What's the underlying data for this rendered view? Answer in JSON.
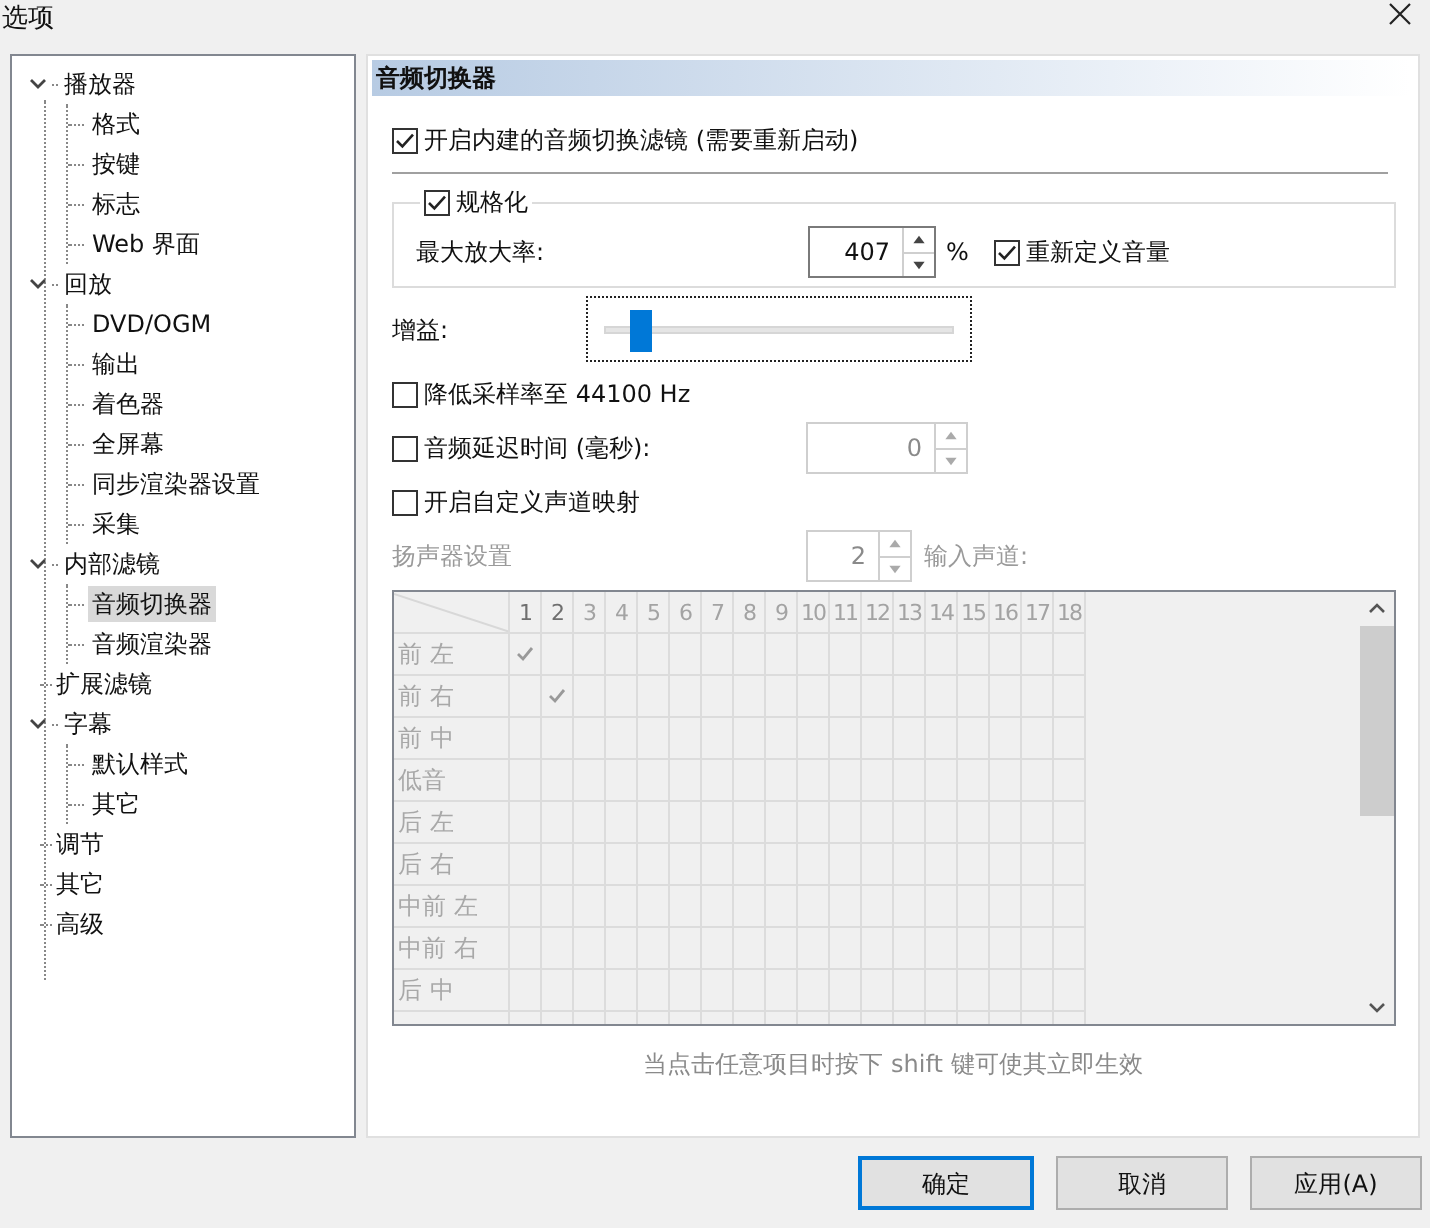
{
  "window": {
    "title": "选项"
  },
  "tree": [
    {
      "label": "播放器",
      "expanded": true,
      "selected": false,
      "children": [
        {
          "label": "格式",
          "selected": false
        },
        {
          "label": "按键",
          "selected": false
        },
        {
          "label": "标志",
          "selected": false
        },
        {
          "label": "Web 界面",
          "selected": false
        }
      ]
    },
    {
      "label": "回放",
      "expanded": true,
      "selected": false,
      "children": [
        {
          "label": "DVD/OGM",
          "selected": false
        },
        {
          "label": "输出",
          "selected": false
        },
        {
          "label": "着色器",
          "selected": false
        },
        {
          "label": "全屏幕",
          "selected": false
        },
        {
          "label": "同步渲染器设置",
          "selected": false
        },
        {
          "label": "采集",
          "selected": false
        }
      ]
    },
    {
      "label": "内部滤镜",
      "expanded": true,
      "selected": false,
      "children": [
        {
          "label": "音频切换器",
          "selected": true
        },
        {
          "label": "音频渲染器",
          "selected": false
        }
      ]
    },
    {
      "label": "扩展滤镜",
      "selected": false
    },
    {
      "label": "字幕",
      "expanded": true,
      "selected": false,
      "children": [
        {
          "label": "默认样式",
          "selected": false
        },
        {
          "label": "其它",
          "selected": false
        }
      ]
    },
    {
      "label": "调节",
      "selected": false
    },
    {
      "label": "其它",
      "selected": false
    },
    {
      "label": "高级",
      "selected": false
    }
  ],
  "panel": {
    "title": "音频切换器",
    "enable_filter": {
      "label": "开启内建的音频切换滤镜 (需要重新启动)",
      "checked": true
    },
    "normalize": {
      "label": "规格化",
      "checked": true,
      "max_amp_label": "最大放大率:",
      "max_amp_value": "407",
      "unit": "%",
      "regain": {
        "label": "重新定义音量",
        "checked": true
      }
    },
    "gain": {
      "label": "增益:",
      "level": 0.1
    },
    "downsample": {
      "label": "降低采样率至 44100 Hz",
      "checked": false
    },
    "delay": {
      "label": "音频延迟时间 (毫秒):",
      "checked": false,
      "value": "0",
      "disabled": true
    },
    "custom_mapping": {
      "label": "开启自定义声道映射",
      "checked": false
    },
    "speaker": {
      "label": "扬声器设置",
      "value": "2",
      "input_label": "输入声道:",
      "disabled": true
    },
    "grid": {
      "columns": [
        {
          "label": "1",
          "active": true
        },
        {
          "label": "2",
          "active": true
        },
        {
          "label": "3",
          "active": false
        },
        {
          "label": "4",
          "active": false
        },
        {
          "label": "5",
          "active": false
        },
        {
          "label": "6",
          "active": false
        },
        {
          "label": "7",
          "active": false
        },
        {
          "label": "8",
          "active": false
        },
        {
          "label": "9",
          "active": false
        },
        {
          "label": "10",
          "active": false
        },
        {
          "label": "11",
          "active": false
        },
        {
          "label": "12",
          "active": false
        },
        {
          "label": "13",
          "active": false
        },
        {
          "label": "14",
          "active": false
        },
        {
          "label": "15",
          "active": false
        },
        {
          "label": "16",
          "active": false
        },
        {
          "label": "17",
          "active": false
        },
        {
          "label": "18",
          "active": false
        }
      ],
      "rows": [
        {
          "label": "前 左",
          "checked": [
            true,
            false,
            false,
            false,
            false,
            false,
            false,
            false,
            false,
            false,
            false,
            false,
            false,
            false,
            false,
            false,
            false,
            false
          ]
        },
        {
          "label": "前 右",
          "checked": [
            false,
            true,
            false,
            false,
            false,
            false,
            false,
            false,
            false,
            false,
            false,
            false,
            false,
            false,
            false,
            false,
            false,
            false
          ]
        },
        {
          "label": "前 中",
          "checked": [
            false,
            false,
            false,
            false,
            false,
            false,
            false,
            false,
            false,
            false,
            false,
            false,
            false,
            false,
            false,
            false,
            false,
            false
          ]
        },
        {
          "label": "低音",
          "checked": [
            false,
            false,
            false,
            false,
            false,
            false,
            false,
            false,
            false,
            false,
            false,
            false,
            false,
            false,
            false,
            false,
            false,
            false
          ]
        },
        {
          "label": "后 左",
          "checked": [
            false,
            false,
            false,
            false,
            false,
            false,
            false,
            false,
            false,
            false,
            false,
            false,
            false,
            false,
            false,
            false,
            false,
            false
          ]
        },
        {
          "label": "后 右",
          "checked": [
            false,
            false,
            false,
            false,
            false,
            false,
            false,
            false,
            false,
            false,
            false,
            false,
            false,
            false,
            false,
            false,
            false,
            false
          ]
        },
        {
          "label": "中前 左",
          "checked": [
            false,
            false,
            false,
            false,
            false,
            false,
            false,
            false,
            false,
            false,
            false,
            false,
            false,
            false,
            false,
            false,
            false,
            false
          ]
        },
        {
          "label": "中前 右",
          "checked": [
            false,
            false,
            false,
            false,
            false,
            false,
            false,
            false,
            false,
            false,
            false,
            false,
            false,
            false,
            false,
            false,
            false,
            false
          ]
        },
        {
          "label": "后 中",
          "checked": [
            false,
            false,
            false,
            false,
            false,
            false,
            false,
            false,
            false,
            false,
            false,
            false,
            false,
            false,
            false,
            false,
            false,
            false
          ]
        }
      ]
    },
    "hint": "当点击任意项目时按下 shift 键可使其立即生效"
  },
  "buttons": [
    {
      "label": "确定",
      "default": true
    },
    {
      "label": "取消",
      "default": false
    },
    {
      "label": "应用(A)",
      "default": false
    }
  ]
}
